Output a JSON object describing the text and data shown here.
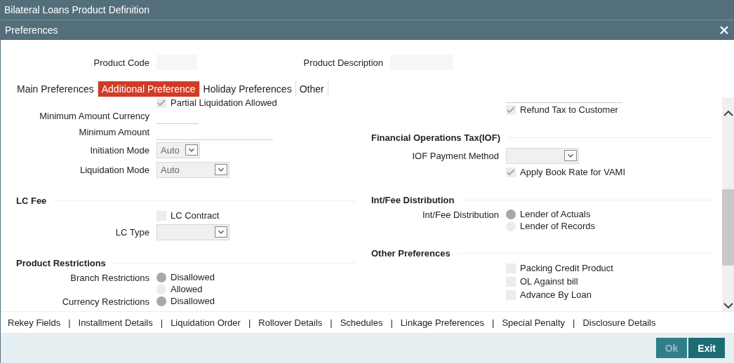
{
  "window": {
    "title": "Bilateral Loans Product Definition"
  },
  "dialog": {
    "title": "Preferences"
  },
  "header_fields": [
    {
      "label": "Product Code"
    },
    {
      "label": "Product Description"
    }
  ],
  "tabs": [
    {
      "label": "Main Preferences",
      "selected": false
    },
    {
      "label": "Additional Preference",
      "selected": true
    },
    {
      "label": "Holiday Preferences",
      "selected": false
    },
    {
      "label": "Other",
      "selected": false
    }
  ],
  "left_sections": [
    {
      "rows": [
        {
          "kind": "checkbox",
          "label": "Partial Liquidation Allowed",
          "checked": true
        },
        {
          "kind": "line",
          "label": "Minimum Amount Currency"
        },
        {
          "kind": "line",
          "label": "Minimum Amount",
          "wide": true
        },
        {
          "kind": "select",
          "label": "Initiation Mode",
          "value": "Auto",
          "compact": true
        },
        {
          "kind": "select",
          "label": "Liquidation Mode",
          "value": "Auto",
          "compact": false
        }
      ]
    },
    {
      "title": "LC Fee",
      "rows": [
        {
          "kind": "checkbox",
          "label": "LC Contract",
          "checked": false
        },
        {
          "kind": "select",
          "label": "LC Type",
          "compact": false
        }
      ]
    },
    {
      "title": "Product Restrictions",
      "rows": [
        {
          "kind": "radio",
          "label": "Branch Restrictions",
          "options": [
            {
              "label": "Disallowed",
              "selected": true
            },
            {
              "label": "Allowed",
              "selected": false
            }
          ]
        },
        {
          "kind": "radio",
          "label": "Currency Restrictions",
          "options": [
            {
              "label": "Disallowed",
              "selected": true
            }
          ]
        }
      ]
    }
  ],
  "right_sections": [
    {
      "rows": [
        {
          "kind": "line",
          "wide": true
        },
        {
          "kind": "checkbox",
          "label": "Refund Tax to Customer",
          "checked": true
        }
      ]
    },
    {
      "title": "Financial Operations Tax(IOF)",
      "rows": [
        {
          "kind": "select",
          "label": "IOF Payment Method",
          "compact": false
        },
        {
          "kind": "checkbox",
          "label": "Apply Book Rate for VAMI",
          "checked": true
        }
      ]
    },
    {
      "title": "Int/Fee Distribution",
      "rows": [
        {
          "kind": "radio",
          "label": "Int/Fee Distribution",
          "options": [
            {
              "label": "Lender of Actuals",
              "selected": true
            },
            {
              "label": "Lender of Records",
              "selected": false
            }
          ]
        }
      ]
    },
    {
      "title": "Other Preferences",
      "rows": [
        {
          "kind": "checkbox",
          "label": "Packing Credit Product",
          "checked": false
        },
        {
          "kind": "checkbox",
          "label": "OL Against bill",
          "checked": false
        },
        {
          "kind": "checkbox",
          "label": "Advance By Loan",
          "checked": false
        }
      ]
    }
  ],
  "footer_links": [
    "Rekey Fields",
    "Installment Details",
    "Liquidation Order",
    "Rollover Details",
    "Schedules",
    "Linkage Preferences",
    "Special Penalty",
    "Disclosure Details"
  ],
  "link_separator": "|",
  "buttons": [
    {
      "label": "Ok",
      "disabled": true
    },
    {
      "label": "Exit",
      "disabled": false
    }
  ]
}
